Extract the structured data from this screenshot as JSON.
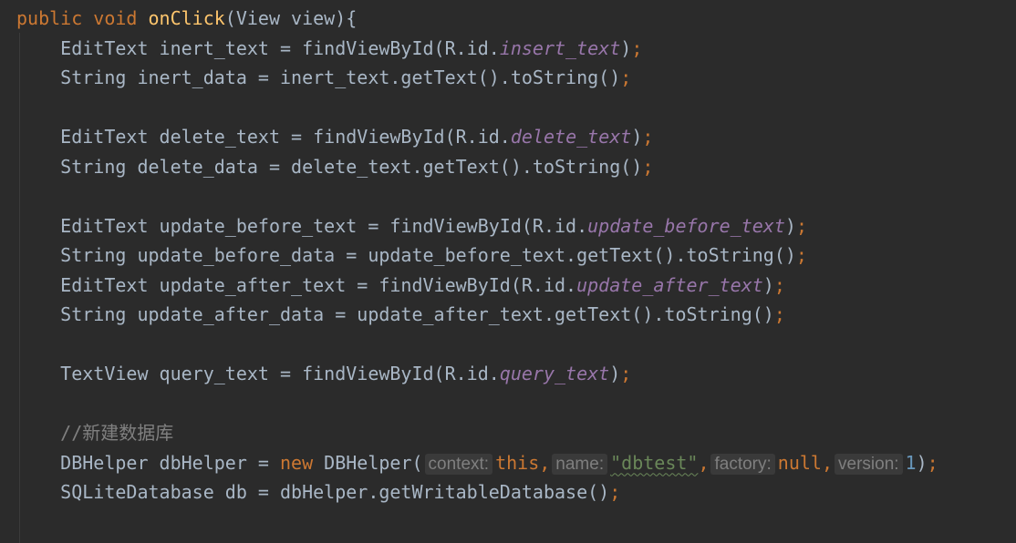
{
  "colors": {
    "background": "#2b2b2b",
    "keyword": "#cc7832",
    "method": "#ffc66d",
    "identifier": "#a9b7c6",
    "field": "#9876aa",
    "string": "#6a8759",
    "number": "#6897bb",
    "comment": "#808080"
  },
  "code_lines": [
    [
      {
        "t": "public void ",
        "c": "kw"
      },
      {
        "t": "onClick",
        "c": "fn"
      },
      {
        "t": "(View view){",
        "c": ""
      }
    ],
    [
      {
        "t": "    EditText inert_text = findViewById(R.id.",
        "c": ""
      },
      {
        "t": "insert_text",
        "c": "fld"
      },
      {
        "t": ")",
        "c": ""
      },
      {
        "t": ";",
        "c": "kw"
      }
    ],
    [
      {
        "t": "    String inert_data = inert_text.getText().toString()",
        "c": ""
      },
      {
        "t": ";",
        "c": "kw"
      }
    ],
    [],
    [
      {
        "t": "    EditText delete_text = findViewById(R.id.",
        "c": ""
      },
      {
        "t": "delete_text",
        "c": "fld"
      },
      {
        "t": ")",
        "c": ""
      },
      {
        "t": ";",
        "c": "kw"
      }
    ],
    [
      {
        "t": "    String delete_data = delete_text.getText().toString()",
        "c": ""
      },
      {
        "t": ";",
        "c": "kw"
      }
    ],
    [],
    [
      {
        "t": "    EditText update_before_text = findViewById(R.id.",
        "c": ""
      },
      {
        "t": "update_before_text",
        "c": "fld"
      },
      {
        "t": ")",
        "c": ""
      },
      {
        "t": ";",
        "c": "kw"
      }
    ],
    [
      {
        "t": "    String update_before_data = update_before_text.getText().toString()",
        "c": ""
      },
      {
        "t": ";",
        "c": "kw"
      }
    ],
    [
      {
        "t": "    EditText update_after_text = findViewById(R.id.",
        "c": ""
      },
      {
        "t": "update_after_text",
        "c": "fld"
      },
      {
        "t": ")",
        "c": ""
      },
      {
        "t": ";",
        "c": "kw"
      }
    ],
    [
      {
        "t": "    String update_after_data = update_after_text.getText().toString()",
        "c": ""
      },
      {
        "t": ";",
        "c": "kw"
      }
    ],
    [],
    [
      {
        "t": "    TextView query_text = findViewById(R.id.",
        "c": ""
      },
      {
        "t": "query_text",
        "c": "fld"
      },
      {
        "t": ")",
        "c": ""
      },
      {
        "t": ";",
        "c": "kw"
      }
    ],
    [],
    [
      {
        "t": "    //新建数据库",
        "c": "cmt"
      }
    ],
    [
      {
        "t": "    DBHelper dbHelper = ",
        "c": ""
      },
      {
        "t": "new ",
        "c": "kw"
      },
      {
        "t": "DBHelper(",
        "c": ""
      },
      {
        "t": "context:",
        "c": "hint"
      },
      {
        "t": "this,",
        "c": "kw"
      },
      {
        "t": "name:",
        "c": "hint"
      },
      {
        "t": "\"dbtest\"",
        "c": "str squig"
      },
      {
        "t": ",",
        "c": "kw"
      },
      {
        "t": "factory:",
        "c": "hint"
      },
      {
        "t": "null,",
        "c": "kw"
      },
      {
        "t": "version:",
        "c": "hint"
      },
      {
        "t": "1",
        "c": "num"
      },
      {
        "t": ")",
        "c": ""
      },
      {
        "t": ";",
        "c": "kw"
      }
    ],
    [
      {
        "t": "    SQLiteDatabase db = dbHelper.getWritableDatabase()",
        "c": ""
      },
      {
        "t": ";",
        "c": "kw"
      }
    ],
    []
  ]
}
